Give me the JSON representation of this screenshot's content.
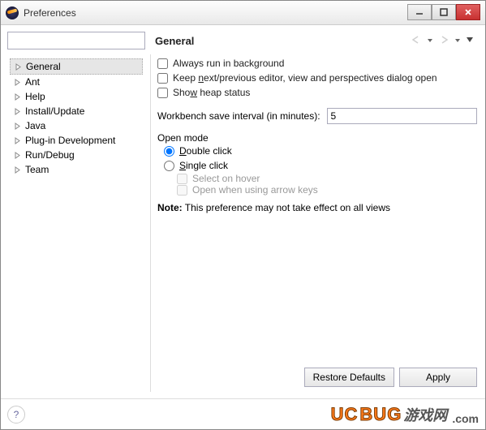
{
  "window": {
    "title": "Preferences"
  },
  "header": {
    "title": "General"
  },
  "tree": {
    "items": [
      {
        "label": "General",
        "selected": true
      },
      {
        "label": "Ant"
      },
      {
        "label": "Help"
      },
      {
        "label": "Install/Update"
      },
      {
        "label": "Java"
      },
      {
        "label": "Plug-in Development"
      },
      {
        "label": "Run/Debug"
      },
      {
        "label": "Team"
      }
    ]
  },
  "opts": {
    "always_bg": "Always run in background",
    "keep_open_pre": "Keep ",
    "keep_open_u": "n",
    "keep_open_post": "ext/previous editor, view and perspectives dialog open",
    "show_heap_pre": "Sho",
    "show_heap_u": "w",
    "show_heap_post": " heap status"
  },
  "interval": {
    "label": "Workbench save interval (in minutes):",
    "value": "5"
  },
  "openmode": {
    "title": "Open mode",
    "double_pre": "",
    "double_u": "D",
    "double_post": "ouble click",
    "single_pre": "",
    "single_u": "S",
    "single_post": "ingle click",
    "hover": "Select on hover",
    "arrow": "Open when using arrow keys"
  },
  "note": {
    "bold": "Note:",
    "text": " This preference may not take effect on all views"
  },
  "buttons": {
    "restore": "Restore Defaults",
    "apply": "Apply"
  },
  "watermark": {
    "uc": "UC",
    "bug": "BUG",
    "cn": "游戏网",
    "com": ".com"
  }
}
